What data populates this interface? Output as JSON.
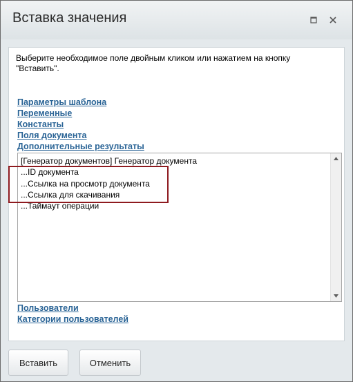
{
  "dialog": {
    "title": "Вставка значения",
    "maximize_icon": "maximize-icon",
    "close_icon": "close-icon"
  },
  "hint": "Выберите необходимое поле двойным кликом или нажатием на кнопку \"Вставить\".",
  "links_top": [
    "Параметры шаблона",
    "Переменные",
    "Константы",
    "Поля документа",
    "Дополнительные результаты"
  ],
  "list_items": [
    "[Генератор документов] Генератор документа",
    "...ID документа",
    "...Ссылка на просмотр документа",
    "...Ссылка для скачивания",
    "...Таймаут операции"
  ],
  "links_bottom": [
    "Пользователи",
    "Категории пользователей"
  ],
  "buttons": {
    "insert": "Вставить",
    "cancel": "Отменить"
  },
  "colors": {
    "link": "#2a6496",
    "highlight": "#8e1a1f",
    "dialog_bg": "#e4e9ec"
  }
}
